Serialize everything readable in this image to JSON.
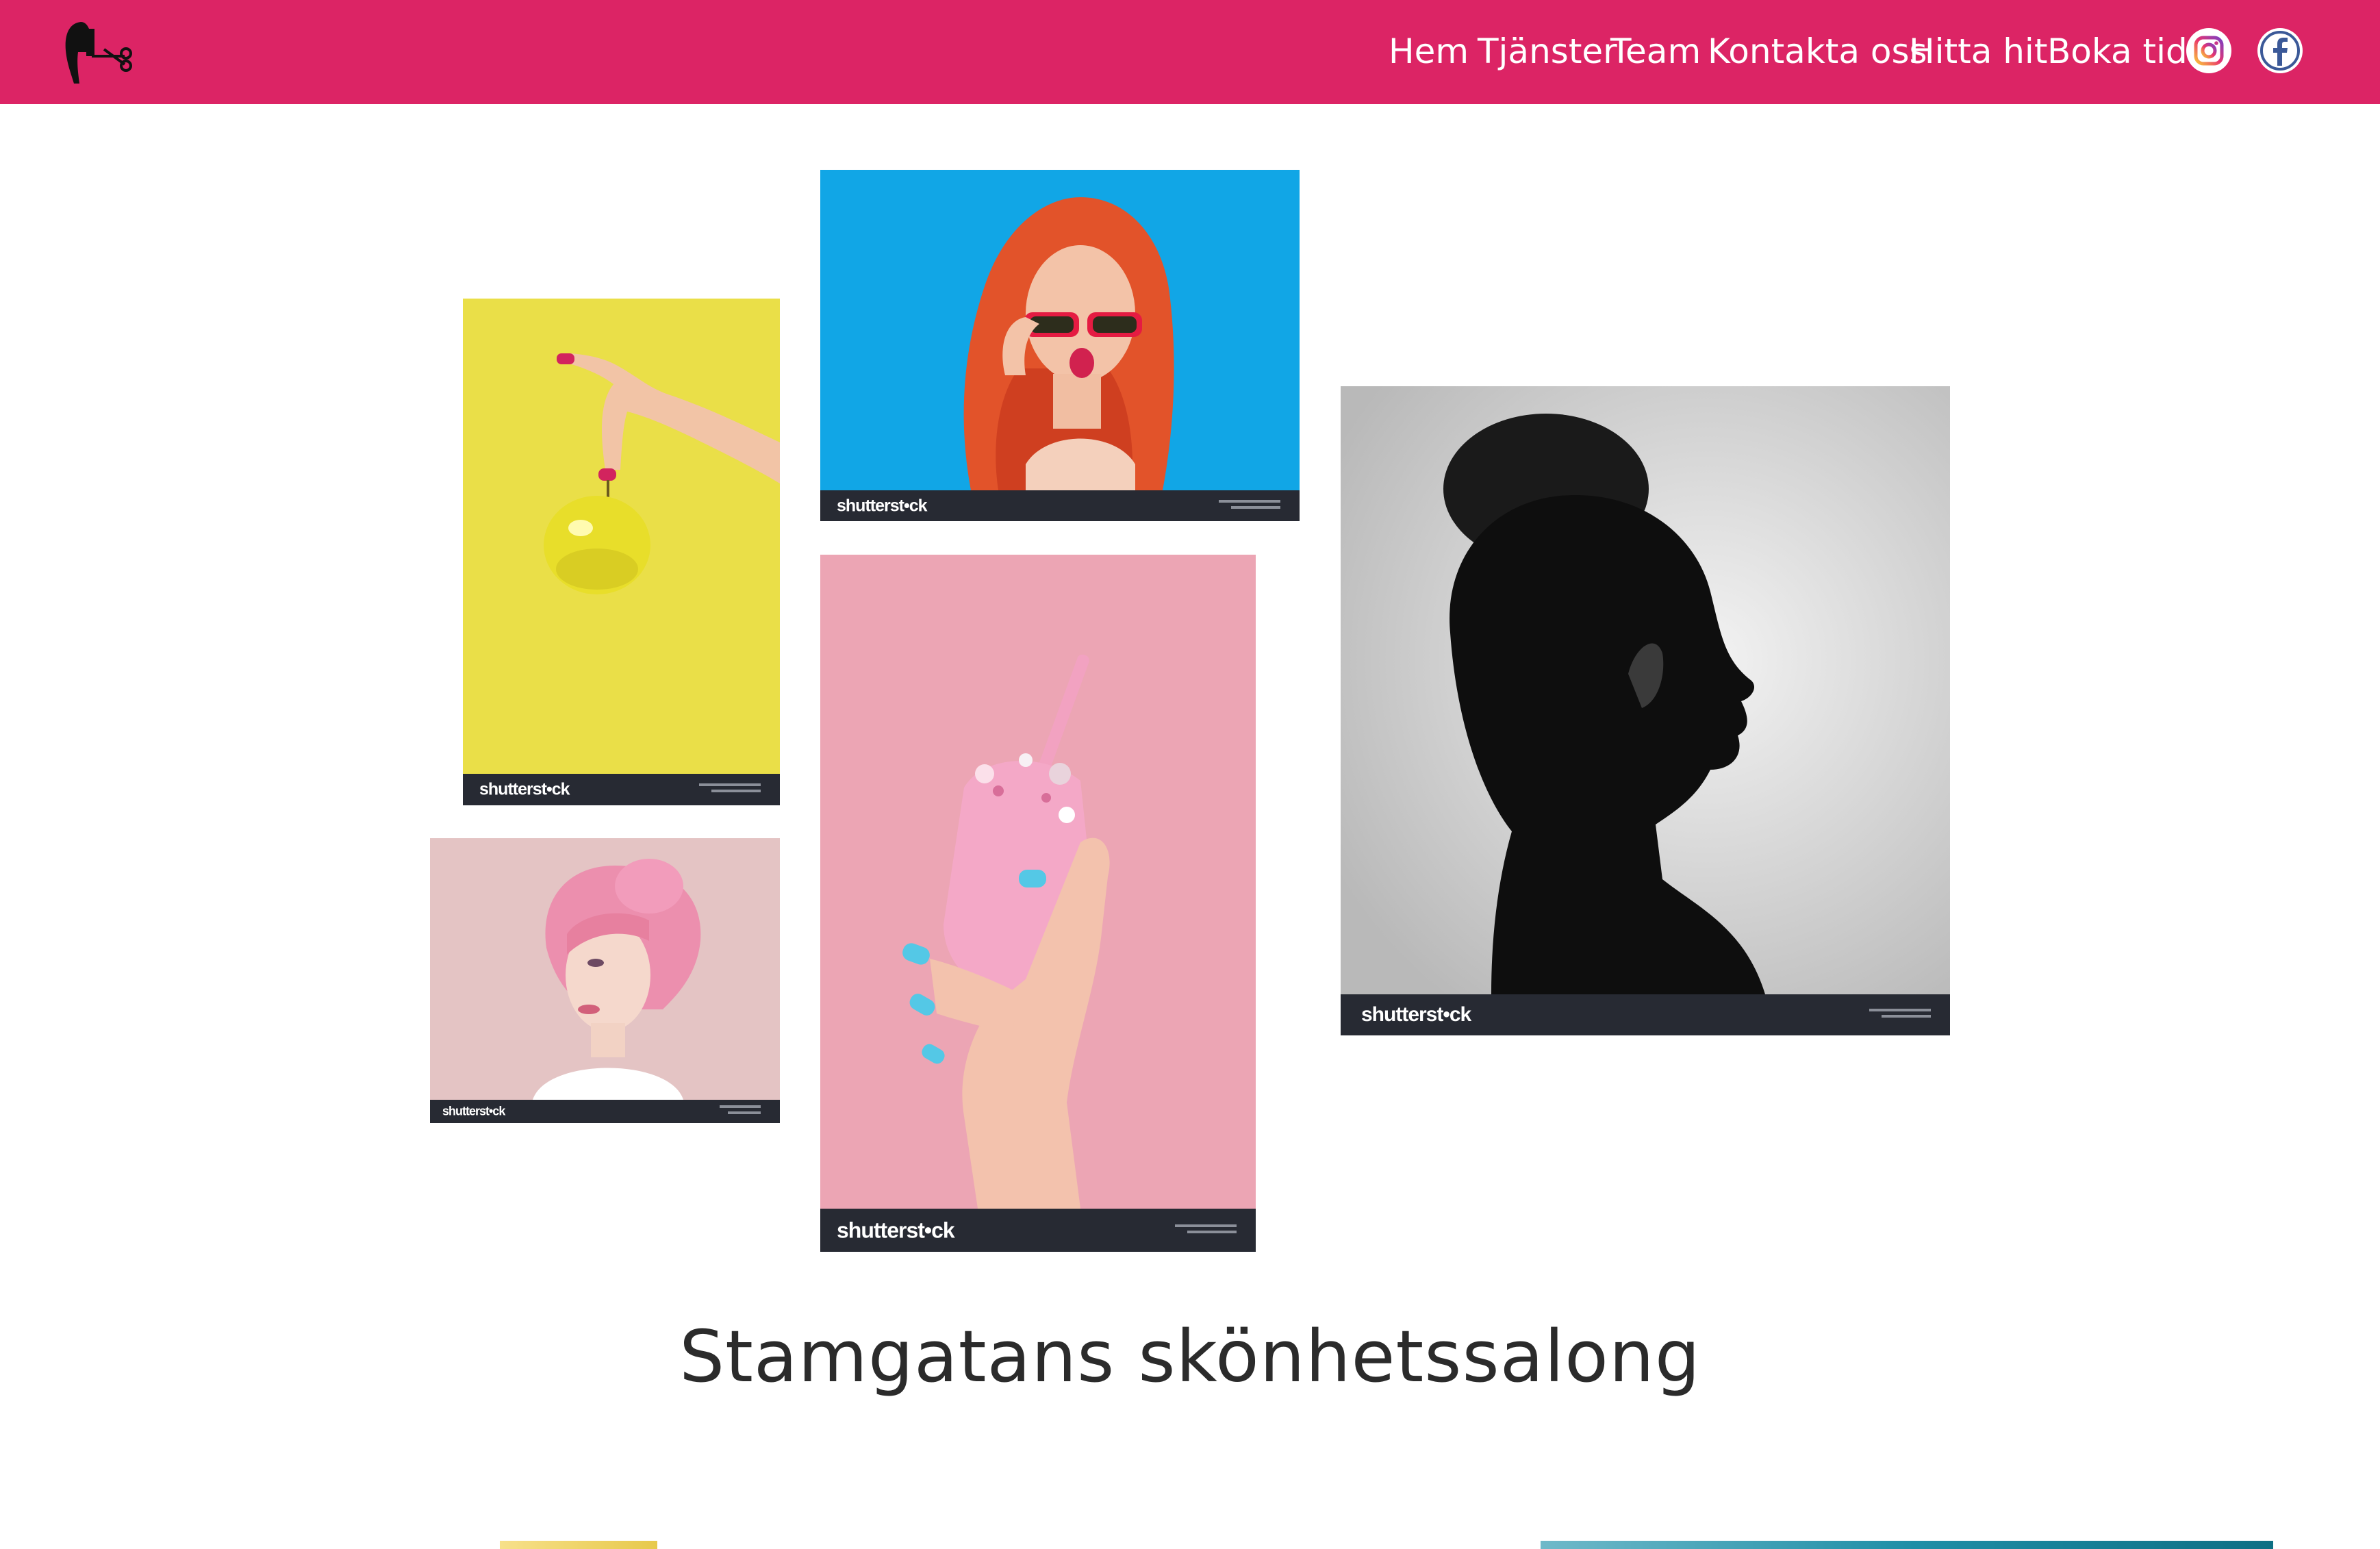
{
  "header": {
    "logo_icon": "scissors-hair-icon",
    "background_color": "#dc2465",
    "nav": [
      {
        "label": "Hem"
      },
      {
        "label": "Tjänster"
      },
      {
        "label": "Team"
      },
      {
        "label": "Kontakta oss"
      },
      {
        "label": "Hitta hit"
      },
      {
        "label": "Boka tid"
      }
    ],
    "social": [
      {
        "icon": "instagram-icon"
      },
      {
        "icon": "facebook-icon"
      }
    ]
  },
  "gallery": {
    "watermark": "shutterst•ck",
    "photos": [
      {
        "name": "yellow-apple-photo",
        "subject": "hand holding yellow apple"
      },
      {
        "name": "red-hair-sunglasses-photo",
        "subject": "red-haired woman with sunglasses"
      },
      {
        "name": "pink-updo-photo",
        "subject": "woman with pink hair updo"
      },
      {
        "name": "pink-cup-photo",
        "subject": "hand holding pink cup with blue nails"
      },
      {
        "name": "black-white-profile-photo",
        "subject": "black and white profile with bun"
      }
    ]
  },
  "main": {
    "title": "Stamgatans skönhetssalong"
  }
}
